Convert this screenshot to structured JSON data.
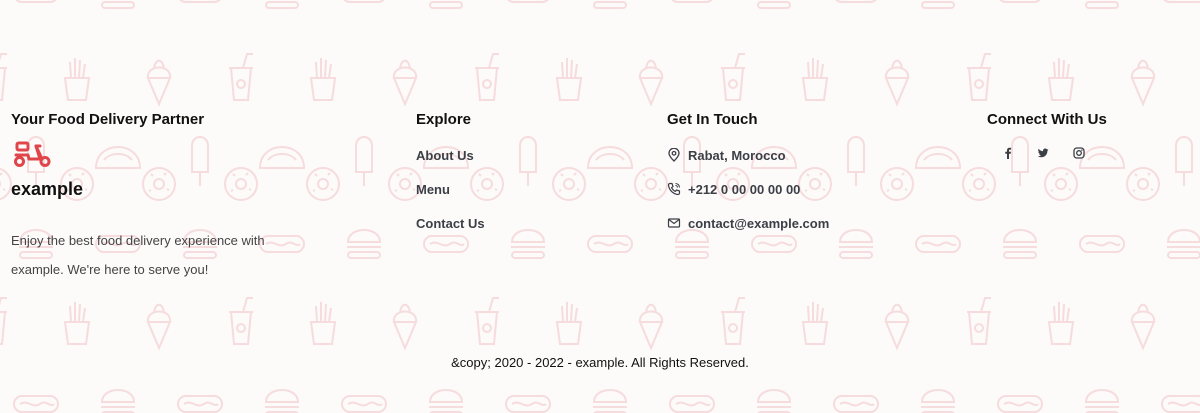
{
  "colors": {
    "accent": "#e0454a",
    "background": "#fdfafa",
    "pattern": "#f6dcdc",
    "link": "#3b3f46"
  },
  "brand": {
    "heading": "Your Food Delivery Partner",
    "icon": "scooter-icon",
    "name": "example",
    "tagline": "Enjoy the best food delivery experience with example. We're here to serve you!"
  },
  "explore": {
    "heading": "Explore",
    "links": [
      {
        "label": "About Us"
      },
      {
        "label": "Menu"
      },
      {
        "label": "Contact Us"
      }
    ]
  },
  "contact": {
    "heading": "Get In Touch",
    "items": [
      {
        "icon": "location-pin-icon",
        "text": "Rabat, Morocco"
      },
      {
        "icon": "phone-icon",
        "text": "+212 0 00 00 00 00"
      },
      {
        "icon": "envelope-icon",
        "text": "contact@example.com"
      }
    ]
  },
  "social": {
    "heading": "Connect With Us",
    "icons": [
      "facebook-icon",
      "twitter-icon",
      "instagram-icon"
    ]
  },
  "copyright": "&copy; 2020 - 2022 - example. All Rights Reserved."
}
